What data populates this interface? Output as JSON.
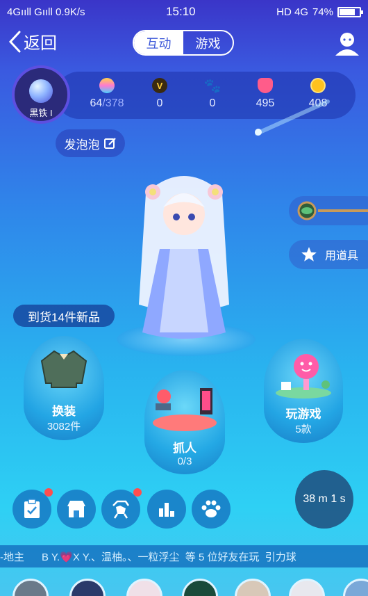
{
  "status_bar": {
    "network": "4Gııll Gııll 0.9K/s",
    "time": "15:10",
    "indicators": "HD 4G",
    "battery": "74%",
    "battery_level": 0.74
  },
  "header": {
    "back_label": "返回",
    "tabs": [
      {
        "label": "互动",
        "active": true
      },
      {
        "label": "游戏",
        "active": false
      }
    ]
  },
  "rank": {
    "label": "黑铁 I"
  },
  "stats": [
    {
      "icon": "pet-face-icon",
      "value": "64",
      "total": "/378",
      "color": "#ff8fd0"
    },
    {
      "icon": "v-badge-icon",
      "value": "0",
      "total": "",
      "color": "#3a2a10"
    },
    {
      "icon": "paw-icon",
      "value": "0",
      "total": "",
      "color": "#ff9a3a"
    },
    {
      "icon": "flower-icon",
      "value": "495",
      "total": "",
      "color": "#ff5c8a"
    },
    {
      "icon": "coin-icon",
      "value": "408",
      "total": "",
      "color": "#ffc21e"
    }
  ],
  "bubble_button": {
    "label": "发泡泡"
  },
  "tools": {
    "use_item_label": "用道具"
  },
  "new_items_tip": "到货14件新品",
  "features": {
    "dress": {
      "title": "换装",
      "sub": "3082件"
    },
    "catch": {
      "title": "抓人",
      "sub": "0/3"
    },
    "games": {
      "title": "玩游戏",
      "sub": "5款"
    }
  },
  "bottom_buttons": [
    {
      "icon": "clipboard-check-icon",
      "badge": true
    },
    {
      "icon": "shop-icon",
      "badge": false
    },
    {
      "icon": "carousel-horse-icon",
      "badge": true
    },
    {
      "icon": "bar-chart-icon",
      "badge": false
    },
    {
      "icon": "paw-icon",
      "badge": false
    }
  ],
  "timer": "38 m 1 s",
  "ticker_text": "-地主      B Y.💗X Y.、温柚。、一粒浮尘  等 5 位好友在玩  引力球"
}
